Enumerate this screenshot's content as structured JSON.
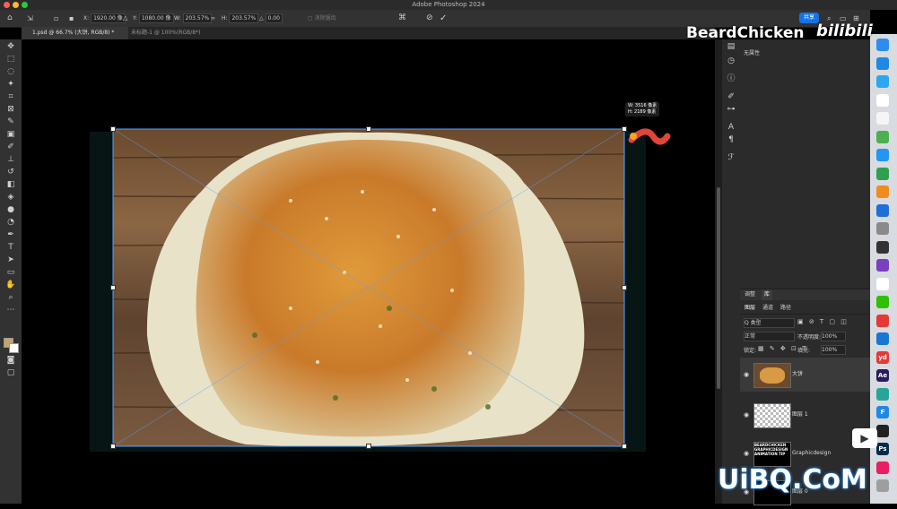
{
  "app_title": "Adobe Photoshop 2024",
  "options": {
    "x_label": "X:",
    "x_value": "1920.00 像",
    "y_label": "Y:",
    "y_value": "1080.00 像",
    "w_label": "W:",
    "w_value": "203.57%",
    "h_label": "H:",
    "h_value": "203.57%",
    "angle_label": "△",
    "angle_value": "0.00",
    "interp_label": "消除锯齿",
    "share_label": "共享"
  },
  "tabs": [
    {
      "label": "1.psd @ 66.7% (大饼, RGB/8) *"
    },
    {
      "label": "未标题-1 @ 100%(RGB/8*)"
    }
  ],
  "transform_info": {
    "w": "W: 3516 像素",
    "h": "H: 2189 像素"
  },
  "properties_panel": {
    "no_props": "无属性"
  },
  "panel_tabs": {
    "adjust": "调整",
    "library": "库"
  },
  "layer_tabs": {
    "layers": "图层",
    "channels": "通道",
    "paths": "路径"
  },
  "layer_filter": {
    "kind": "Q 类型"
  },
  "layer_controls": {
    "blend_mode": "正常",
    "opacity_label": "不透明度:",
    "opacity_value": "100%",
    "lock_label": "锁定:",
    "fill_label": "填充:",
    "fill_value": "100%"
  },
  "layers": [
    {
      "name": "大饼"
    },
    {
      "name": "图层 1"
    },
    {
      "name": "Graphicdesign"
    },
    {
      "name": "图层 0"
    }
  ],
  "watermarks": {
    "channel": "BeardChicken",
    "site": "bilibili",
    "uibq": "UiBQ.CoM",
    "thumb_text": "BEARDCHICKEN GRAPHICDESIGN ANIMATION TIP"
  },
  "dock_apps": [
    {
      "name": "finder-icon",
      "label": "",
      "color": "#2d8cf0"
    },
    {
      "name": "appstore-icon",
      "label": "",
      "color": "#1e88e5"
    },
    {
      "name": "safari-icon",
      "label": "",
      "color": "#2aa7f0"
    },
    {
      "name": "calendar-icon",
      "label": "",
      "color": "#ffffff"
    },
    {
      "name": "reminders-icon",
      "label": "",
      "color": "#f5f5f5"
    },
    {
      "name": "maps-icon",
      "label": "",
      "color": "#4caf50"
    },
    {
      "name": "messages-icon",
      "label": "",
      "color": "#2196f3"
    },
    {
      "name": "numbers-icon",
      "label": "",
      "color": "#2e9f4f"
    },
    {
      "name": "pages-icon",
      "label": "",
      "color": "#f08c1e"
    },
    {
      "name": "keynote-icon",
      "label": "",
      "color": "#1e6fd9"
    },
    {
      "name": "settings-icon",
      "label": "",
      "color": "#8a8a8a"
    },
    {
      "name": "chatgpt-icon",
      "label": "",
      "color": "#333333"
    },
    {
      "name": "tor-icon",
      "label": "",
      "color": "#7b3fbf"
    },
    {
      "name": "qq-icon",
      "label": "",
      "color": "#ffffff"
    },
    {
      "name": "wechat-icon",
      "label": "",
      "color": "#2dc100"
    },
    {
      "name": "chrome-icon",
      "label": "",
      "color": "#e53935"
    },
    {
      "name": "cloud-icon",
      "label": "",
      "color": "#1976d2"
    },
    {
      "name": "youdao-icon",
      "label": "yd",
      "color": "#e53935"
    },
    {
      "name": "ae-icon",
      "label": "Ae",
      "color": "#2a1a5e"
    },
    {
      "name": "quicktime-icon",
      "label": "",
      "color": "#26a69a"
    },
    {
      "name": "feishu-icon",
      "label": "F",
      "color": "#1e88e5"
    },
    {
      "name": "app-icon",
      "label": "",
      "color": "#222222"
    },
    {
      "name": "ps-icon",
      "label": "Ps",
      "color": "#0a2a4a"
    },
    {
      "name": "photos-icon",
      "label": "",
      "color": "#e91e63"
    },
    {
      "name": "trash-icon",
      "label": "",
      "color": "#9e9e9e"
    }
  ]
}
